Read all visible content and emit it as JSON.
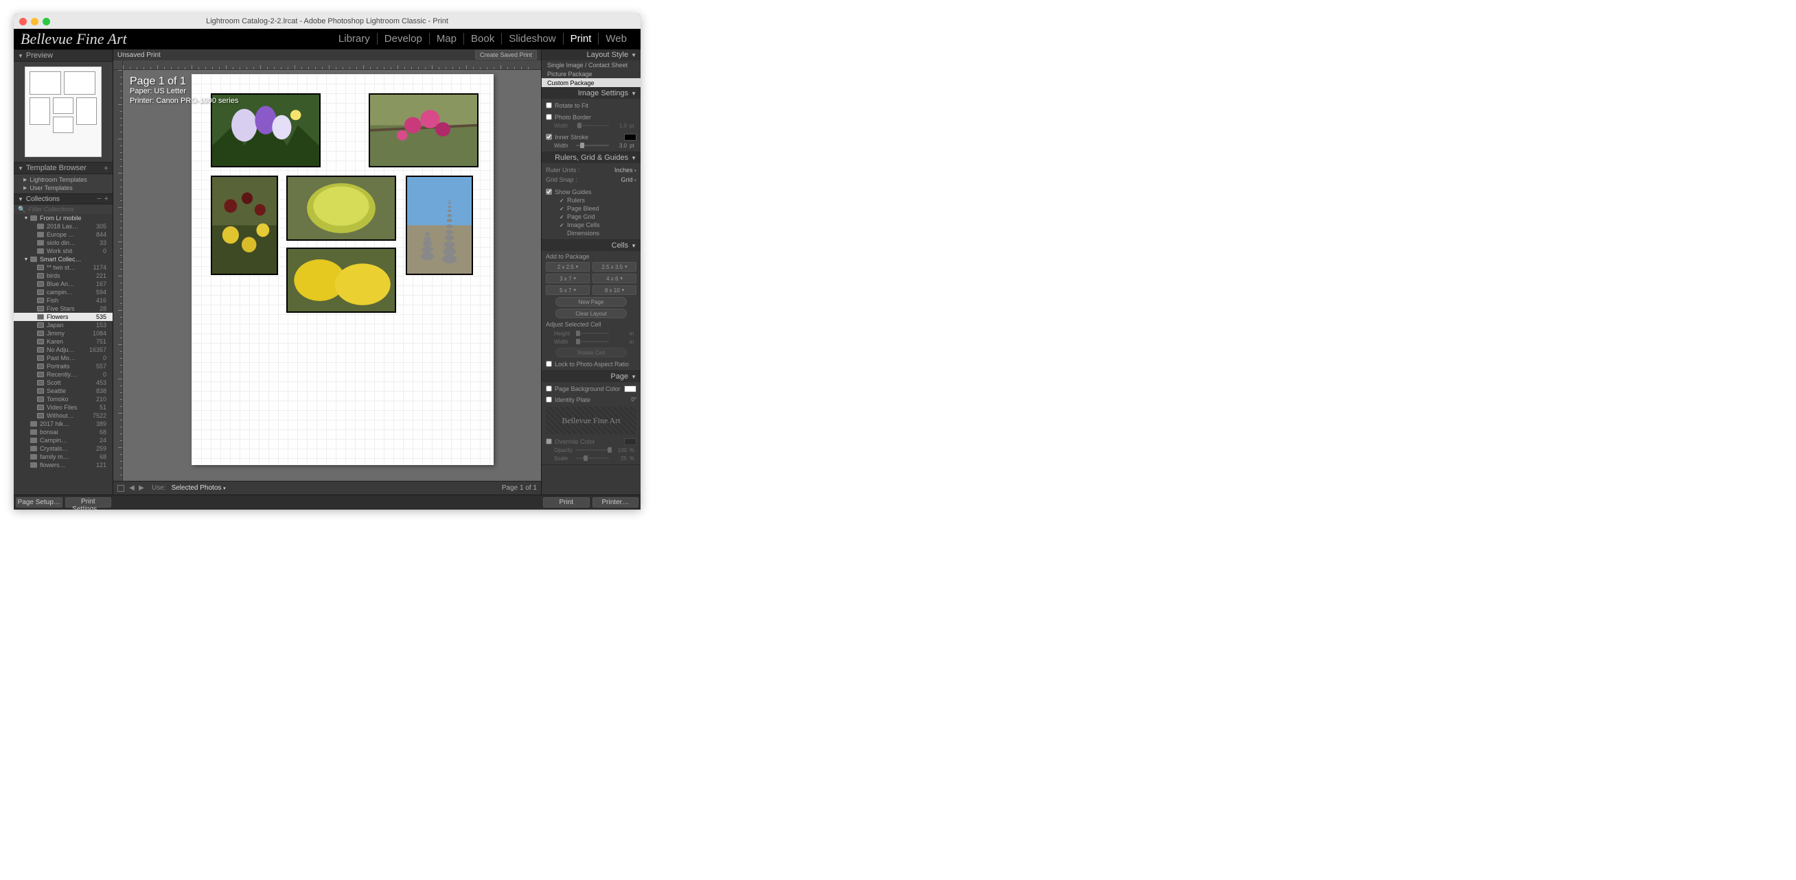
{
  "window": {
    "title": "Lightroom Catalog-2-2.lrcat - Adobe Photoshop Lightroom Classic - Print"
  },
  "identity_plate": "Bellevue Fine Art",
  "modules": [
    "Library",
    "Develop",
    "Map",
    "Book",
    "Slideshow",
    "Print",
    "Web"
  ],
  "active_module": "Print",
  "left": {
    "preview_title": "Preview",
    "template_title": "Template Browser",
    "template_groups": [
      "Lightroom Templates",
      "User Templates"
    ],
    "collections_title": "Collections",
    "collections": [
      {
        "type": "parent",
        "depth": 0,
        "name": "From Lr mobile",
        "count": "",
        "expanded": true
      },
      {
        "type": "set",
        "depth": 1,
        "name": "2018 Las…",
        "count": "305"
      },
      {
        "type": "set",
        "depth": 1,
        "name": "Europe …",
        "count": "844"
      },
      {
        "type": "set",
        "depth": 1,
        "name": "siolo din…",
        "count": "33"
      },
      {
        "type": "set",
        "depth": 1,
        "name": "Work shit",
        "count": "0"
      },
      {
        "type": "parent",
        "depth": 0,
        "name": "Smart Collec…",
        "count": "",
        "expanded": true
      },
      {
        "type": "smart",
        "depth": 1,
        "name": "** two st…",
        "count": "1174"
      },
      {
        "type": "smart",
        "depth": 1,
        "name": "birds",
        "count": "221"
      },
      {
        "type": "smart",
        "depth": 1,
        "name": "Blue An…",
        "count": "167"
      },
      {
        "type": "smart",
        "depth": 1,
        "name": "campin…",
        "count": "594"
      },
      {
        "type": "smart",
        "depth": 1,
        "name": "Fish",
        "count": "416"
      },
      {
        "type": "smart",
        "depth": 1,
        "name": "Five Stars",
        "count": "28"
      },
      {
        "type": "smart",
        "depth": 1,
        "name": "Flowers",
        "count": "535",
        "selected": true
      },
      {
        "type": "smart",
        "depth": 1,
        "name": "Japan",
        "count": "153"
      },
      {
        "type": "smart",
        "depth": 1,
        "name": "Jimmy",
        "count": "1084"
      },
      {
        "type": "smart",
        "depth": 1,
        "name": "Karen",
        "count": "751"
      },
      {
        "type": "smart",
        "depth": 1,
        "name": "No Adju…",
        "count": "16357"
      },
      {
        "type": "smart",
        "depth": 1,
        "name": "Past Mo…",
        "count": "0"
      },
      {
        "type": "smart",
        "depth": 1,
        "name": "Portraits",
        "count": "557"
      },
      {
        "type": "smart",
        "depth": 1,
        "name": "Recently…",
        "count": "0"
      },
      {
        "type": "smart",
        "depth": 1,
        "name": "Scott",
        "count": "453"
      },
      {
        "type": "smart",
        "depth": 1,
        "name": "Seattle",
        "count": "838"
      },
      {
        "type": "smart",
        "depth": 1,
        "name": "Tomoko",
        "count": "210"
      },
      {
        "type": "smart",
        "depth": 1,
        "name": "Video Files",
        "count": "51"
      },
      {
        "type": "smart",
        "depth": 1,
        "name": "Without…",
        "count": "7522"
      },
      {
        "type": "set",
        "depth": 0,
        "name": "2017 hik…",
        "count": "389"
      },
      {
        "type": "set",
        "depth": 0,
        "name": "bonsai",
        "count": "68"
      },
      {
        "type": "set",
        "depth": 0,
        "name": "Campin…",
        "count": "24"
      },
      {
        "type": "set",
        "depth": 0,
        "name": "Crystals…",
        "count": "259"
      },
      {
        "type": "set",
        "depth": 0,
        "name": "family m…",
        "count": "68"
      },
      {
        "type": "set",
        "depth": 0,
        "name": "flowers…",
        "count": "121"
      }
    ]
  },
  "center": {
    "unsaved": "Unsaved Print",
    "create_btn": "Create Saved Print",
    "overlay": {
      "page": "Page 1 of 1",
      "paper": "Paper:  US Letter",
      "printer": "Printer:  Canon PRO-1000 series"
    },
    "bottom": {
      "use_label": "Use:",
      "use_value": "Selected Photos",
      "page": "Page 1 of 1"
    }
  },
  "right": {
    "layout_style_title": "Layout Style",
    "layout_styles": [
      "Single Image / Contact Sheet",
      "Picture Package",
      "Custom Package"
    ],
    "layout_style_selected": "Custom Package",
    "image_settings": {
      "title": "Image Settings",
      "rotate": "Rotate to Fit",
      "border": "Photo Border",
      "border_width": "Width",
      "border_val": "1.0",
      "border_unit": "pt",
      "stroke": "Inner Stroke",
      "stroke_width": "Width",
      "stroke_val": "3.0",
      "stroke_unit": "pt"
    },
    "rulers": {
      "title": "Rulers, Grid & Guides",
      "ruler_units_k": "Ruler Units :",
      "ruler_units_v": "Inches",
      "grid_snap_k": "Grid Snap :",
      "grid_snap_v": "Grid",
      "show_guides": "Show Guides",
      "items": [
        {
          "label": "Rulers",
          "checked": true
        },
        {
          "label": "Page Bleed",
          "checked": true
        },
        {
          "label": "Page Grid",
          "checked": true
        },
        {
          "label": "Image Cells",
          "checked": true
        },
        {
          "label": "Dimensions",
          "checked": false
        }
      ]
    },
    "cells": {
      "title": "Cells",
      "add": "Add to Package",
      "presets": [
        "2 x 2.5",
        "2.5 x 3.5",
        "3 x 7",
        "4 x 6",
        "5 x 7",
        "8 x 10"
      ],
      "new_page": "New Page",
      "clear": "Clear Layout",
      "adjust": "Adjust Selected Cell",
      "height": "Height",
      "width": "Width",
      "unit": "in",
      "rotate": "Rotate Cell",
      "lock": "Lock to Photo Aspect Ratio"
    },
    "page": {
      "title": "Page",
      "bg": "Page Background Color",
      "id": "Identity Plate",
      "id_angle": "0°",
      "id_text": "Bellevue Fine Art",
      "override": "Override Color",
      "opacity": "Opacity",
      "opacity_val": "100",
      "opacity_unit": "%",
      "scale": "Scale",
      "scale_val": "25",
      "scale_unit": "%"
    }
  },
  "footer": {
    "page_setup": "Page Setup…",
    "print_settings": "Print Settings…",
    "print": "Print",
    "printer": "Printer…"
  }
}
